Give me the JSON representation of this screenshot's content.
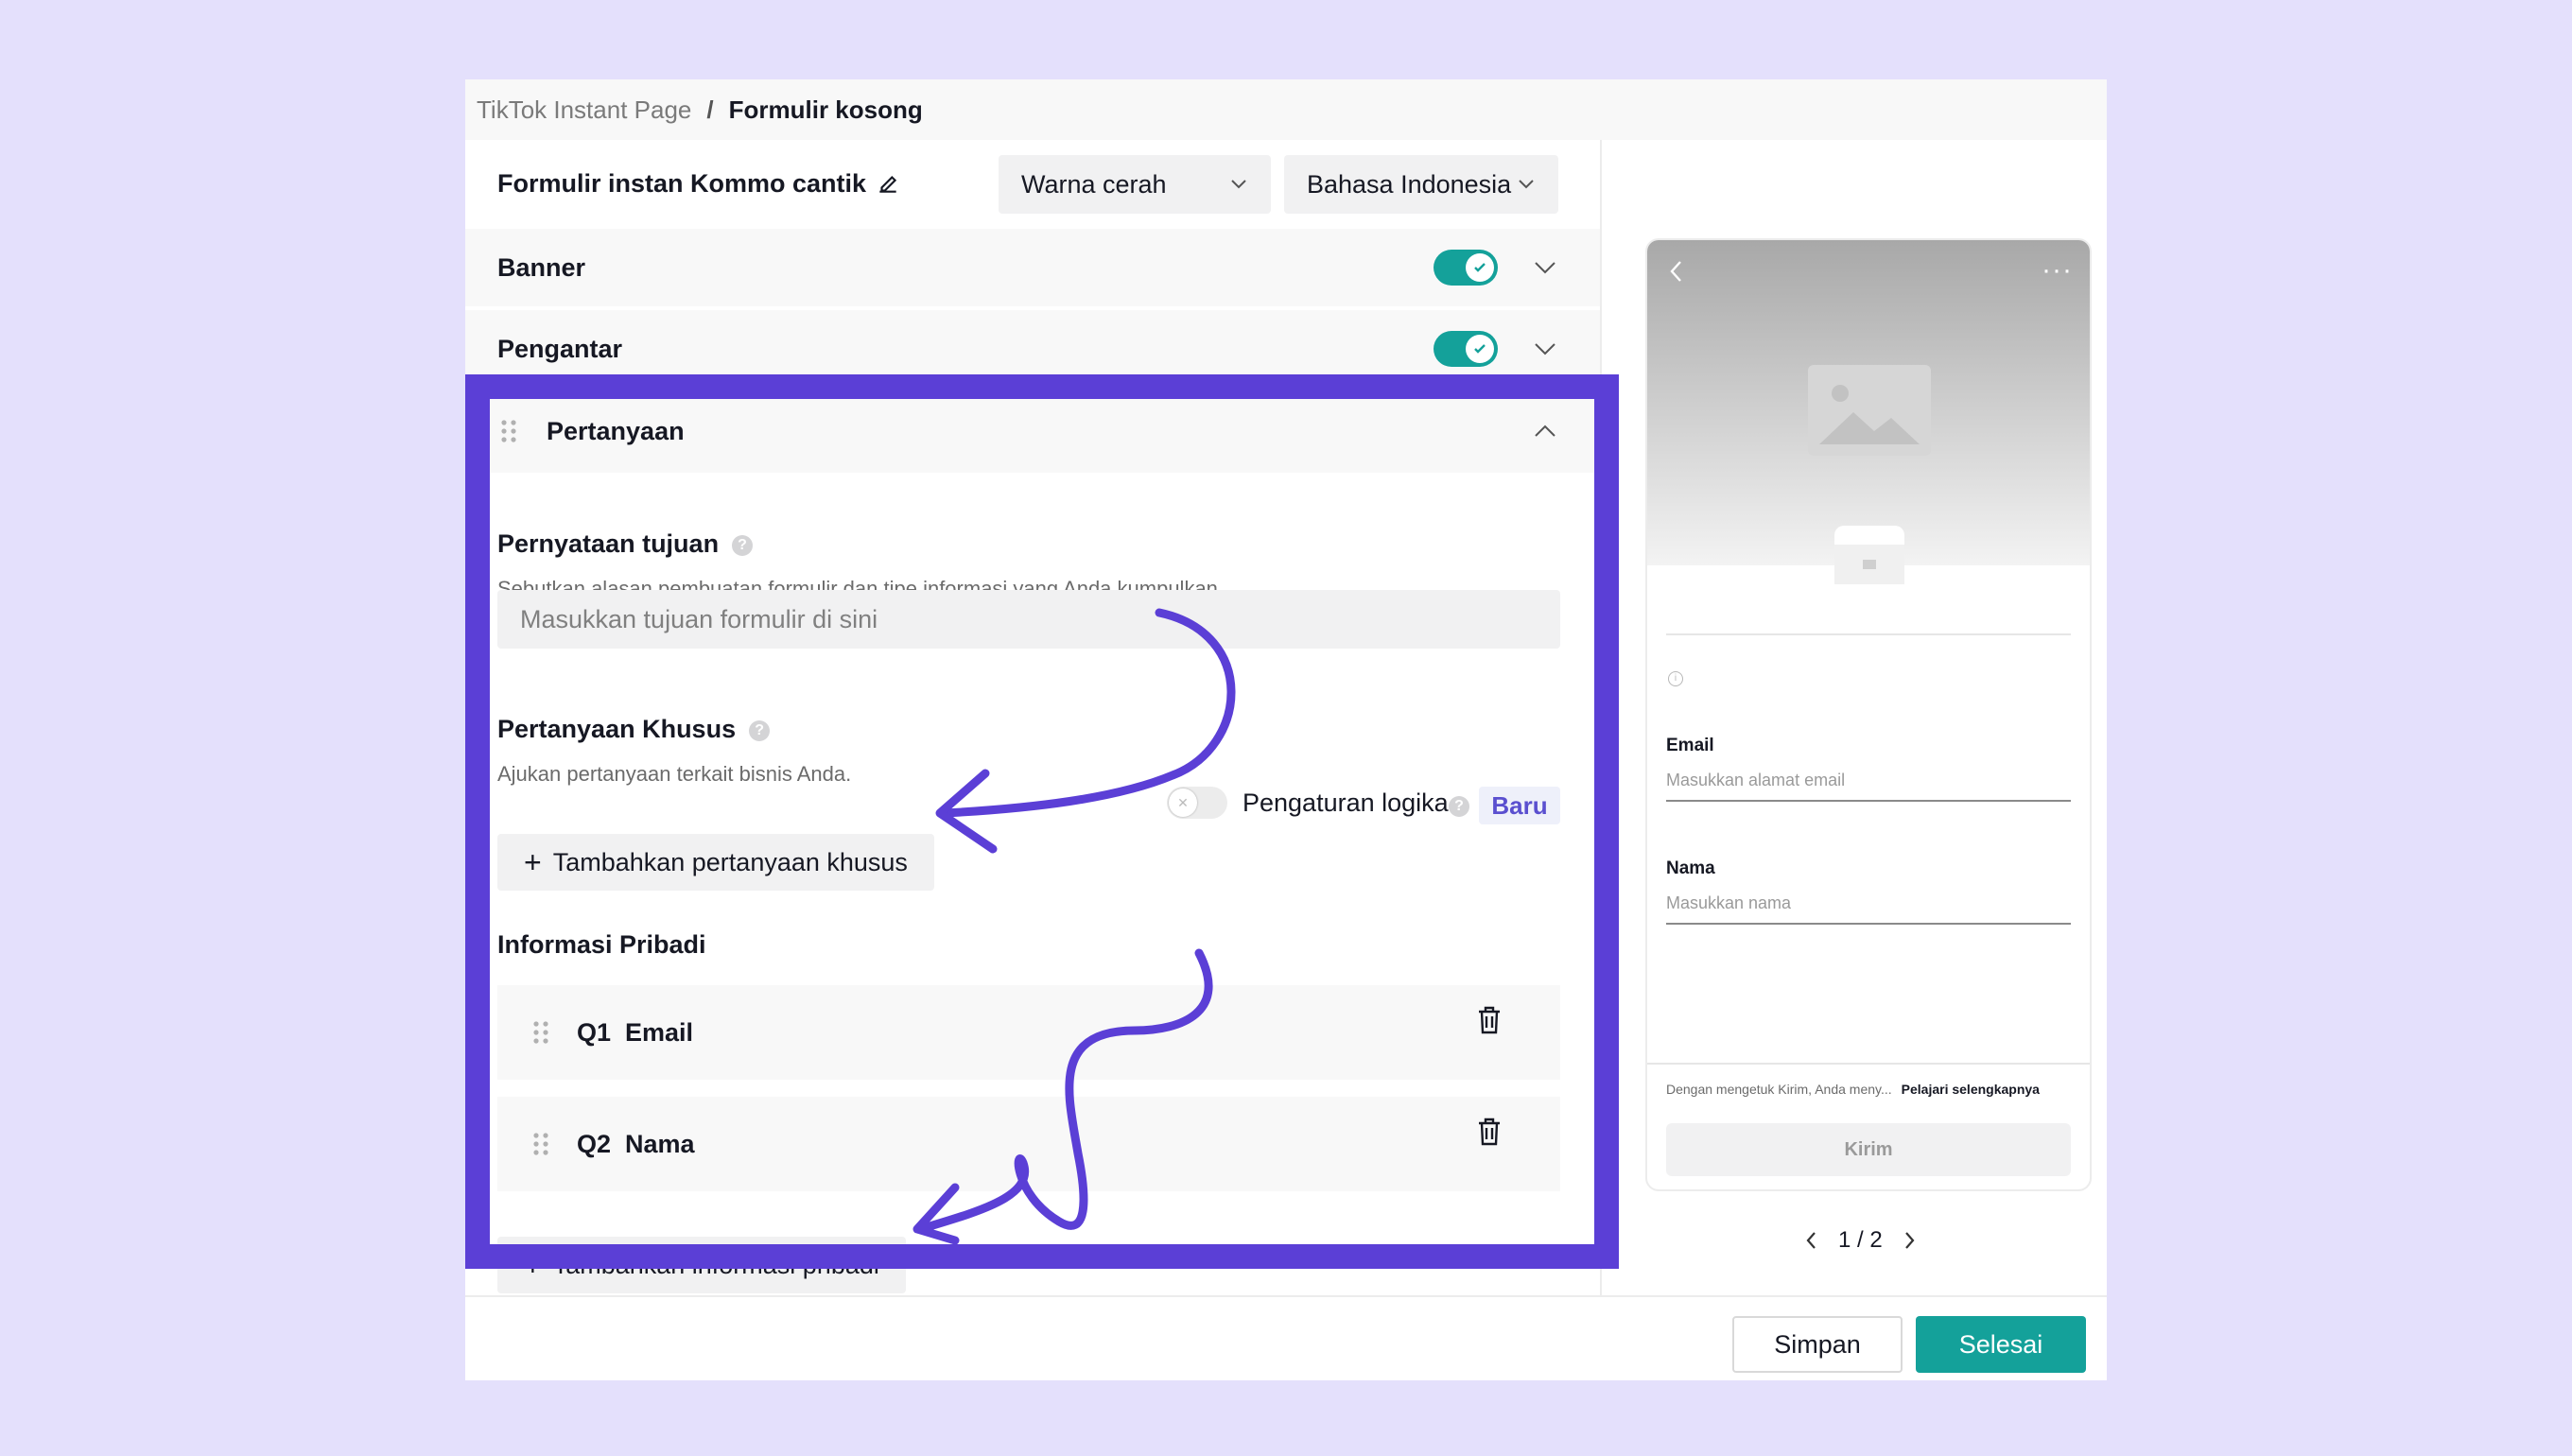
{
  "breadcrumb": {
    "root": "TikTok Instant Page",
    "separator": "/",
    "current": "Formulir kosong"
  },
  "form": {
    "name": "Formulir instan Kommo cantik",
    "theme_select": "Warna cerah",
    "language_select": "Bahasa Indonesia"
  },
  "sections": {
    "banner": {
      "label": "Banner",
      "enabled": true
    },
    "intro": {
      "label": "Pengantar",
      "enabled": true
    },
    "questions": {
      "label": "Pertanyaan"
    }
  },
  "purpose": {
    "label": "Pernyataan tujuan",
    "description": "Sebutkan alasan pembuatan formulir dan tipe informasi yang Anda kumpulkan.",
    "placeholder": "Masukkan tujuan formulir di sini"
  },
  "custom": {
    "label": "Pertanyaan Khusus",
    "description": "Ajukan pertanyaan terkait bisnis Anda.",
    "add_button": "Tambahkan pertanyaan khusus",
    "logic_label": "Pengaturan logika",
    "logic_enabled": false,
    "new_badge": "Baru"
  },
  "personal": {
    "label": "Informasi Pribadi",
    "items": [
      {
        "label": "Q1  Email"
      },
      {
        "label": "Q2  Nama"
      }
    ],
    "add_button": "Tambahkan informasi pribadi"
  },
  "preview": {
    "fields": [
      {
        "label": "Email",
        "placeholder": "Masukkan alamat email"
      },
      {
        "label": "Nama",
        "placeholder": "Masukkan nama"
      }
    ],
    "terms_text": "Dengan mengetuk Kirim, Anda meny...",
    "terms_link": "Pelajari selengkapnya",
    "submit": "Kirim",
    "pager": "1 / 2"
  },
  "footer": {
    "save": "Simpan",
    "done": "Selesai"
  },
  "colors": {
    "accent": "#14a19a",
    "highlight": "#5b3fd6",
    "background": "#e4e0fc"
  },
  "icons": [
    "edit-icon",
    "chevron-down-icon",
    "chevron-up-icon",
    "check-icon",
    "drag-handle-icon",
    "help-icon",
    "trash-icon",
    "plus-icon",
    "image-icon",
    "back-icon",
    "more-icon"
  ]
}
